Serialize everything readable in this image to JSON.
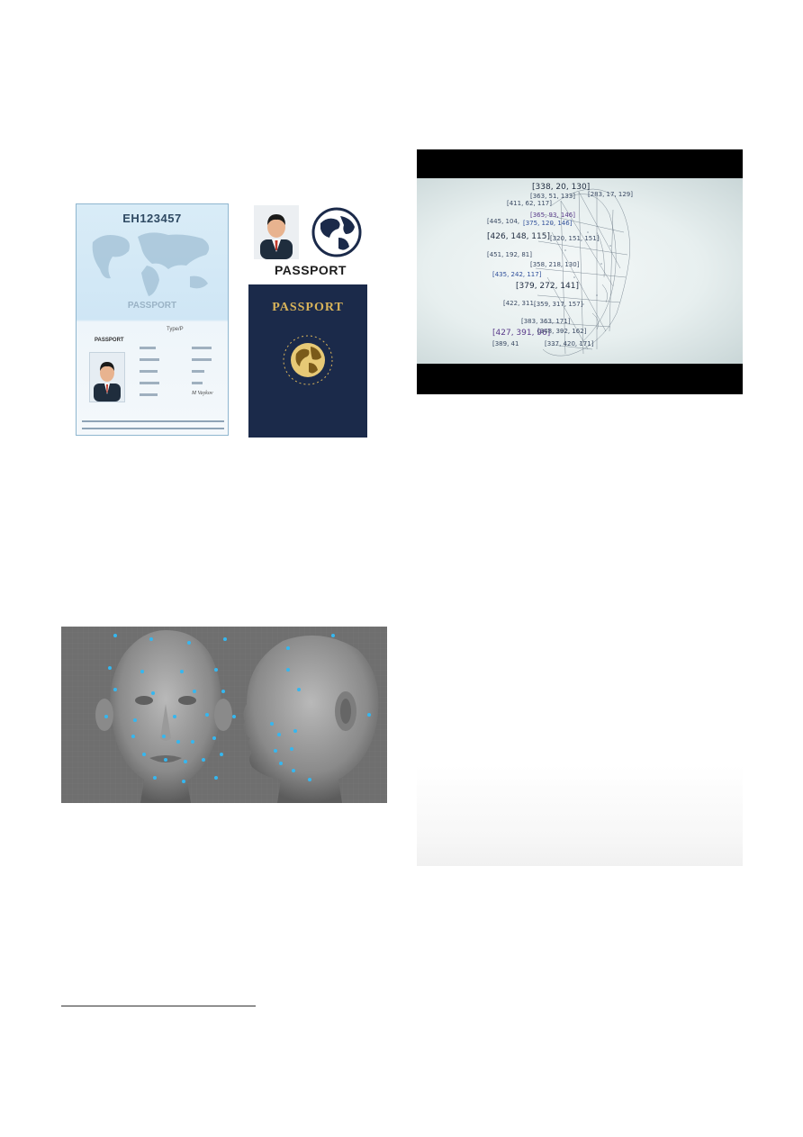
{
  "passport": {
    "number": "EH123457",
    "page_watermark": "PASSPORT",
    "type_label": "Type/P",
    "page_label": "PASSPORT",
    "signature": "M Vaykov",
    "emblem_title": "PASSPORT",
    "cover_title": "PASSPORT"
  },
  "face_mesh": {
    "coordinates": [
      "[338, 20, 130]",
      "[283, 17, 129]",
      "[363, 51, 133]",
      "[411, 62, 117]",
      "[365, 93, 146]",
      "[445, 104,",
      "[375, 120, 146]",
      "[426, 148, 115]",
      "[320, 151, 151]",
      "[451, 192, 81]",
      "[358, 218, 130]",
      "[435, 242, 117]",
      "[379, 272, 141]",
      "[422, 311,",
      "[359, 317, 157]",
      "[383, 363, 171]",
      "[427, 391, 96]",
      "[389, 41",
      "[348, 392, 162]",
      "[337, 420, 171]"
    ]
  },
  "colors": {
    "landmark_dot": "#35b7f0",
    "passport_cover": "#1b2a4a",
    "cover_gold": "#d9b45a"
  }
}
